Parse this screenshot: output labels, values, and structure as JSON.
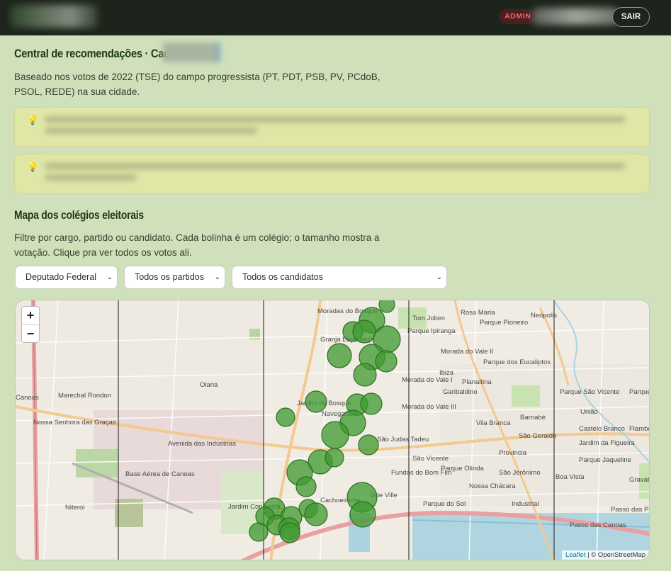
{
  "header": {
    "admin_badge": "ADMIN",
    "logout_label": "SAIR"
  },
  "recommendations": {
    "title": "Central de recomendações · Cac",
    "intro": "Baseado nos votos de 2022 (TSE) do campo progressista (PT, PDT, PSB, PV, PCdoB, PSOL, REDE) na sua cidade.",
    "tip_icon": "lightbulb-icon"
  },
  "map_section": {
    "title": "Mapa dos colégios eleitorais",
    "description": "Filtre por cargo, partido ou candidato. Cada bolinha é um colégio; o tamanho mostra a votação. Clique pra ver todos os votos ali."
  },
  "filters": {
    "cargo": "Deputado Federal",
    "partido": "Todos os partidos",
    "candidato": "Todos os candidatos"
  },
  "map": {
    "zoom_in": "+",
    "zoom_out": "−",
    "attribution_leaflet": "Leaflet",
    "attribution_osm": " | © OpenStreetMap",
    "marker_color": "#3d9a2f",
    "labels": [
      "Moradas do Bosque",
      "Tom Jobim",
      "Rosa Maria",
      "Parque Pioneiro",
      "Neópolis",
      "Parque Ipiranga",
      "Granja Esperança",
      "Morada do Vale II",
      "Parque dos Eucaliptos",
      "Ibiza",
      "Planaltina",
      "Olaria",
      "Canoas",
      "Marechal Rondon",
      "Morada do Vale I",
      "Garibaldino",
      "Parque São Vicente",
      "Parque do Búzios",
      "Jardim do Bosque",
      "Morada do Vale III",
      "União",
      "Nossa Senhora das Graças",
      "Navegantes",
      "Barnabé",
      "Vila Branca",
      "Castelo Branco",
      "Flambo",
      "São Geraldo",
      "Jardim da Figueira",
      "São Judas Tadeu",
      "Avenida das Indústrias",
      "Provincia",
      "Parque Jaqueline",
      "Base Aérea de Canoas",
      "São Vicente",
      "Parque Olinda",
      "São Jerônimo",
      "Fundos do Bom Fim",
      "Gravataí",
      "Nossa Chácara",
      "Boa Vista",
      "Cachoeirinha",
      "Vale Ville",
      "Niteroi",
      "Industrial",
      "Jardim Conquista",
      "Parque do Sol",
      "Passo das Pedras",
      "Passo das Canoas"
    ]
  }
}
